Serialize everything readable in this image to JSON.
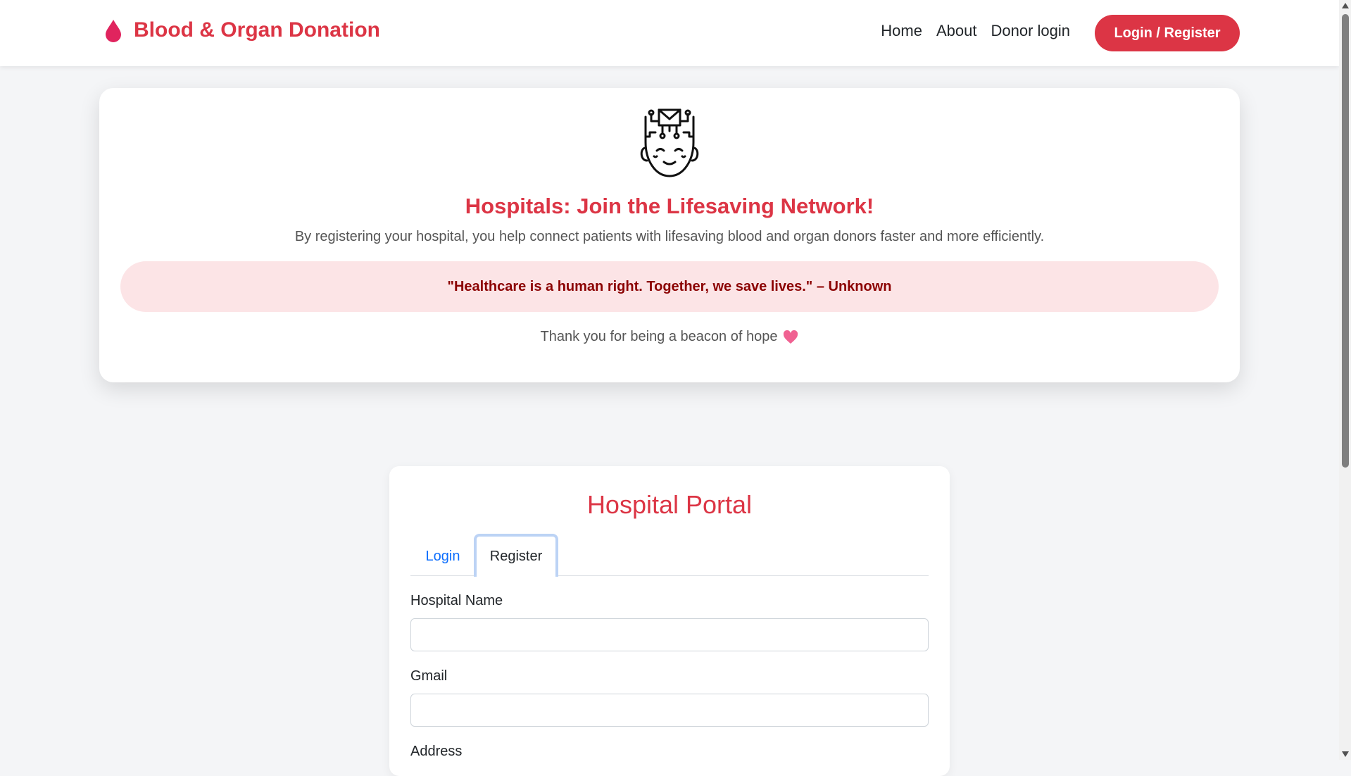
{
  "navbar": {
    "brand": "Blood & Organ Donation",
    "links": [
      "Home",
      "About",
      "Donor login"
    ],
    "cta": "Login / Register"
  },
  "hero": {
    "title": "Hospitals: Join the Lifesaving Network!",
    "subtitle": "By registering your hospital, you help connect patients with lifesaving blood and organ donors faster and more efficiently.",
    "quote": "\"Healthcare is a human right. Together, we save lives.\" – Unknown",
    "thanks": "Thank you for being a beacon of hope"
  },
  "portal": {
    "title": "Hospital Portal",
    "tabs": {
      "login": "Login",
      "register": "Register",
      "active": "register"
    },
    "fields": {
      "hospital_name": {
        "label": "Hospital Name",
        "value": ""
      },
      "gmail": {
        "label": "Gmail",
        "value": ""
      },
      "address": {
        "label": "Address",
        "value": ""
      }
    }
  },
  "colors": {
    "brand": "#dc3545",
    "quote_bg": "#fce4e6",
    "quote_text": "#8b0000",
    "link": "#0d6efd"
  }
}
